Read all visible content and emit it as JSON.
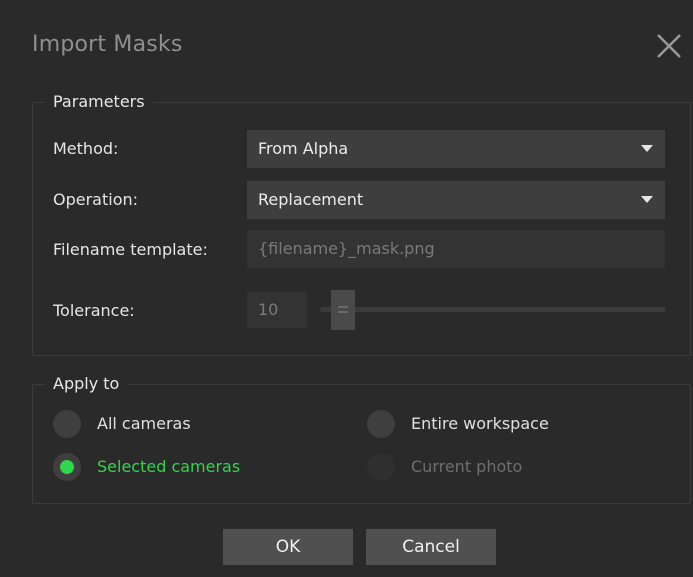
{
  "dialog": {
    "title": "Import Masks"
  },
  "parameters": {
    "legend": "Parameters",
    "method_label": "Method:",
    "method_value": "From Alpha",
    "operation_label": "Operation:",
    "operation_value": "Replacement",
    "filename_label": "Filename template:",
    "filename_value": "{filename}_mask.png",
    "tolerance_label": "Tolerance:",
    "tolerance_value": "10",
    "tolerance_slider_fraction": 0.0
  },
  "apply_to": {
    "legend": "Apply to",
    "options": [
      {
        "label": "All cameras",
        "checked": false,
        "enabled": true
      },
      {
        "label": "Selected cameras",
        "checked": true,
        "enabled": true
      },
      {
        "label": "Entire workspace",
        "checked": false,
        "enabled": true
      },
      {
        "label": "Current photo",
        "checked": false,
        "enabled": false
      }
    ]
  },
  "buttons": {
    "ok_label": "OK",
    "cancel_label": "Cancel"
  },
  "colors": {
    "accent": "#2ed84a",
    "background": "#2a2a2a",
    "control": "#3e3e3e"
  }
}
